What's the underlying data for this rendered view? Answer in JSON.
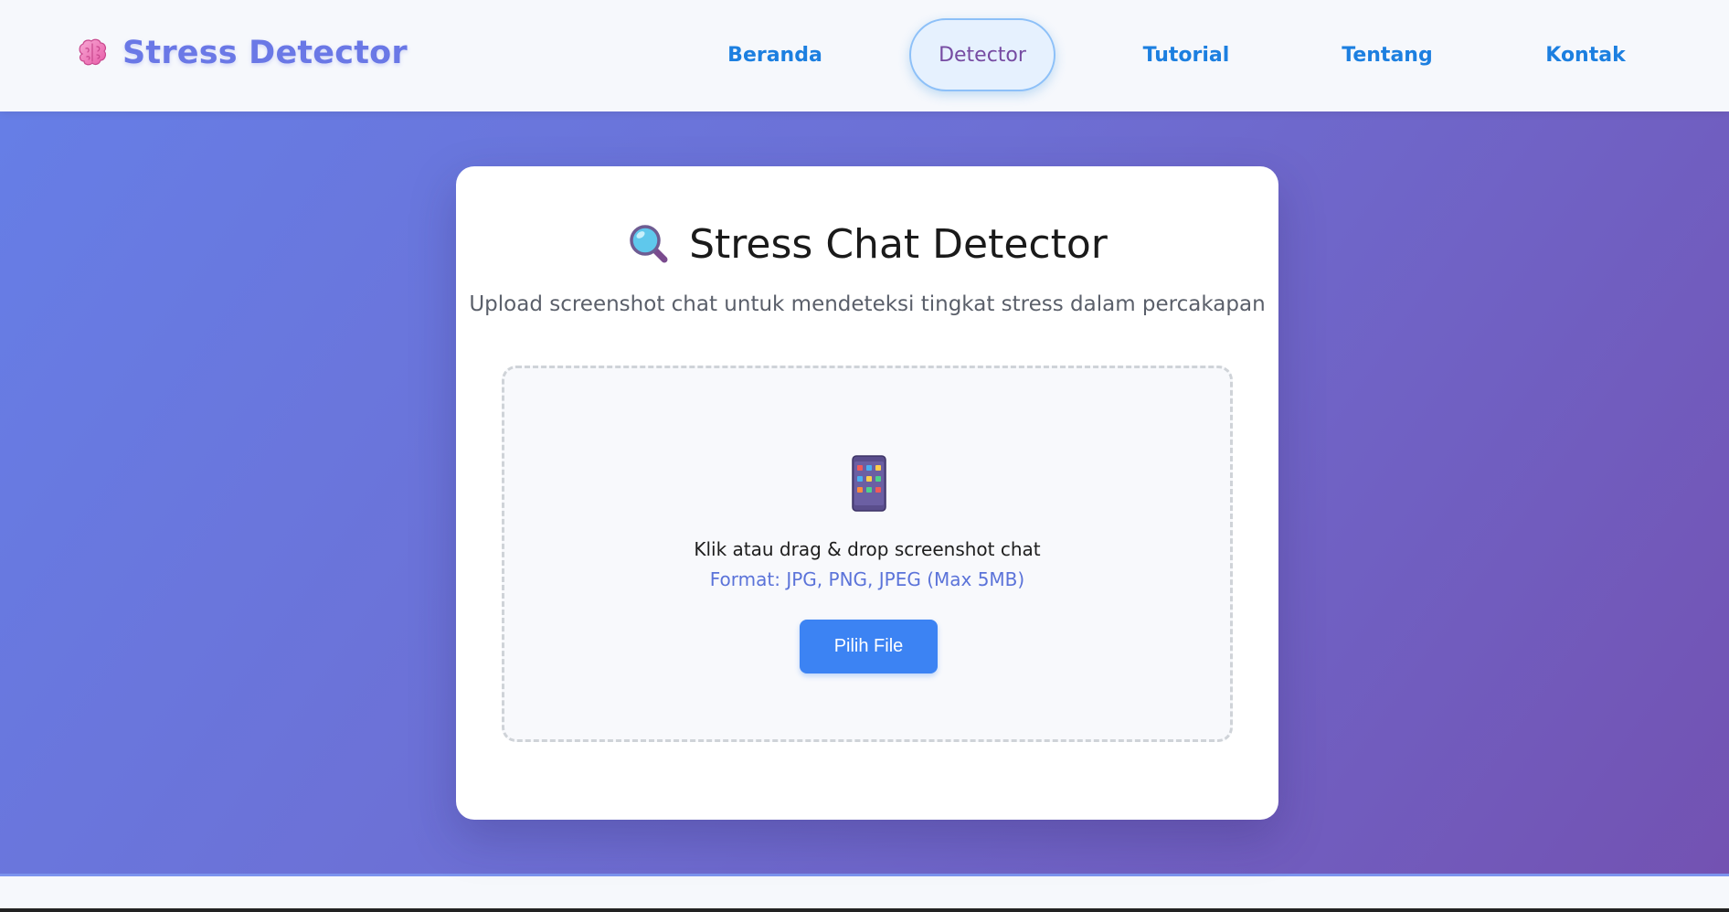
{
  "navbar": {
    "brand_icon": "brain-icon",
    "brand_text": "Stress Detector",
    "links": [
      {
        "label": "Beranda",
        "active": false
      },
      {
        "label": "Detector",
        "active": true
      },
      {
        "label": "Tutorial",
        "active": false
      },
      {
        "label": "Tentang",
        "active": false
      },
      {
        "label": "Kontak",
        "active": false
      }
    ]
  },
  "card": {
    "title_icon": "magnifying-glass-icon",
    "title": "Stress Chat Detector",
    "subtitle": "Upload screenshot chat untuk mendeteksi tingkat stress dalam percakapan"
  },
  "upload": {
    "icon": "mobile-phone-icon",
    "main_text": "Klik atau drag & drop screenshot chat",
    "format_text": "Format: JPG, PNG, JPEG (Max 5MB)",
    "button_label": "Pilih File"
  },
  "colors": {
    "brand": "#6a78e6",
    "nav_link": "#1c7fe0",
    "nav_active_text": "#764ba2",
    "gradient_start": "#667ee6",
    "gradient_end": "#7352b2",
    "button": "#3c83f3",
    "format_text": "#5b73d9"
  }
}
